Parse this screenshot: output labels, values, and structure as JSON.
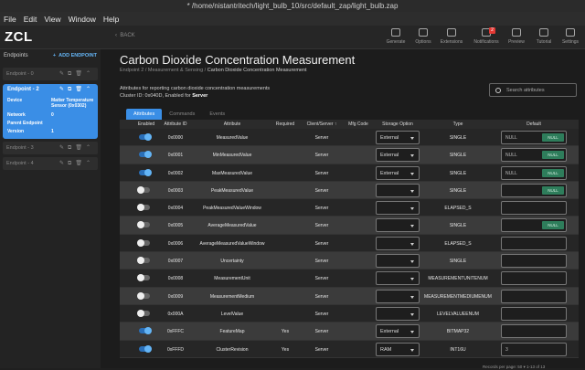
{
  "window": {
    "title": "* /home/nistantritech/light_bulb_10/src/default_zap/light_bulb.zap"
  },
  "menu": [
    "File",
    "Edit",
    "View",
    "Window",
    "Help"
  ],
  "app": {
    "name": "ZCL",
    "back_label": "BACK"
  },
  "toolbar": [
    {
      "label": "Generate",
      "icon": "generate-icon"
    },
    {
      "label": "Options",
      "icon": "options-icon"
    },
    {
      "label": "Extensions",
      "icon": "extensions-icon"
    },
    {
      "label": "Notifications",
      "icon": "bell-icon",
      "badge": "2"
    },
    {
      "label": "Preview",
      "icon": "preview-icon"
    },
    {
      "label": "Tutorial",
      "icon": "tutorial-icon"
    },
    {
      "label": "Settings",
      "icon": "gear-icon"
    }
  ],
  "sidebar": {
    "header": "Endpoints",
    "add_label": "ADD ENDPOINT",
    "endpoints": [
      {
        "label": "Endpoint - 0"
      },
      {
        "label": "Endpoint - 3"
      },
      {
        "label": "Endpoint - 4"
      }
    ],
    "selected": {
      "label": "Endpoint - 2",
      "device_label": "Device",
      "device_value_1": "Matter Temperature",
      "device_value_2": "Sensor (0x0302)",
      "network_label": "Network",
      "network_value": "0",
      "parent_label": "Parent Endpoint",
      "version_label": "Version",
      "version_value": "1"
    }
  },
  "main": {
    "title": "Carbon Dioxide Concentration Measurement",
    "breadcrumb": [
      "Endpoint 2",
      "Measurement & Sensing",
      "Carbon Dioxide Concentration Measurement"
    ],
    "desc1": "Attributes for reporting carbon dioxide concentration measurements",
    "desc2_prefix": "Cluster ID: 0x040D, Enabled for",
    "desc2_side": "Server",
    "search_placeholder": "Search attributes",
    "tabs": [
      "Attributes",
      "Commands",
      "Events"
    ]
  },
  "table": {
    "headers": [
      "Enabled",
      "Attribute ID",
      "Attribute",
      "Required",
      "Client/Server",
      "Mfg Code",
      "Storage Option",
      "Type",
      "Default"
    ],
    "rows": [
      {
        "on": true,
        "id": "0x0000",
        "name": "MeasuredValue",
        "req": "",
        "side": "Server",
        "storage": "External",
        "type": "SINGLE",
        "def": "NULL",
        "null": "NULL"
      },
      {
        "on": true,
        "id": "0x0001",
        "name": "MinMeasuredValue",
        "req": "",
        "side": "Server",
        "storage": "External",
        "type": "SINGLE",
        "def": "NULL",
        "null": "NULL"
      },
      {
        "on": true,
        "id": "0x0002",
        "name": "MaxMeasuredValue",
        "req": "",
        "side": "Server",
        "storage": "External",
        "type": "SINGLE",
        "def": "NULL",
        "null": "NULL"
      },
      {
        "on": false,
        "id": "0x0003",
        "name": "PeakMeasuredValue",
        "req": "",
        "side": "Server",
        "storage": "",
        "type": "SINGLE",
        "def": "",
        "null": "NULL"
      },
      {
        "on": false,
        "id": "0x0004",
        "name": "PeakMeasuredValueWindow",
        "req": "",
        "side": "Server",
        "storage": "",
        "type": "ELAPSED_S",
        "def": "",
        "null": ""
      },
      {
        "on": false,
        "id": "0x0005",
        "name": "AverageMeasuredValue",
        "req": "",
        "side": "Server",
        "storage": "",
        "type": "SINGLE",
        "def": "",
        "null": "NULL"
      },
      {
        "on": false,
        "id": "0x0006",
        "name": "AverageMeasuredValueWindow",
        "req": "",
        "side": "Server",
        "storage": "",
        "type": "ELAPSED_S",
        "def": "",
        "null": ""
      },
      {
        "on": false,
        "id": "0x0007",
        "name": "Uncertainty",
        "req": "",
        "side": "Server",
        "storage": "",
        "type": "SINGLE",
        "def": "",
        "null": ""
      },
      {
        "on": false,
        "id": "0x0008",
        "name": "MeasurementUnit",
        "req": "",
        "side": "Server",
        "storage": "",
        "type": "MEASUREMENTUNITENUM",
        "def": "",
        "null": ""
      },
      {
        "on": false,
        "id": "0x0009",
        "name": "MeasurementMedium",
        "req": "",
        "side": "Server",
        "storage": "",
        "type": "MEASUREMENTMEDIUMENUM",
        "def": "",
        "null": ""
      },
      {
        "on": false,
        "id": "0x000A",
        "name": "LevelValue",
        "req": "",
        "side": "Server",
        "storage": "",
        "type": "LEVELVALUEENUM",
        "def": "",
        "null": ""
      },
      {
        "on": true,
        "id": "0xFFFC",
        "name": "FeatureMap",
        "req": "Yes",
        "side": "Server",
        "storage": "External",
        "type": "BITMAP32",
        "def": "",
        "null": ""
      },
      {
        "on": true,
        "id": "0xFFFD",
        "name": "ClusterRevision",
        "req": "Yes",
        "side": "Server",
        "storage": "RAM",
        "type": "INT16U",
        "def": "3",
        "null": ""
      }
    ],
    "footer": "Records per page:  50  ▾    1-13 of 13"
  }
}
